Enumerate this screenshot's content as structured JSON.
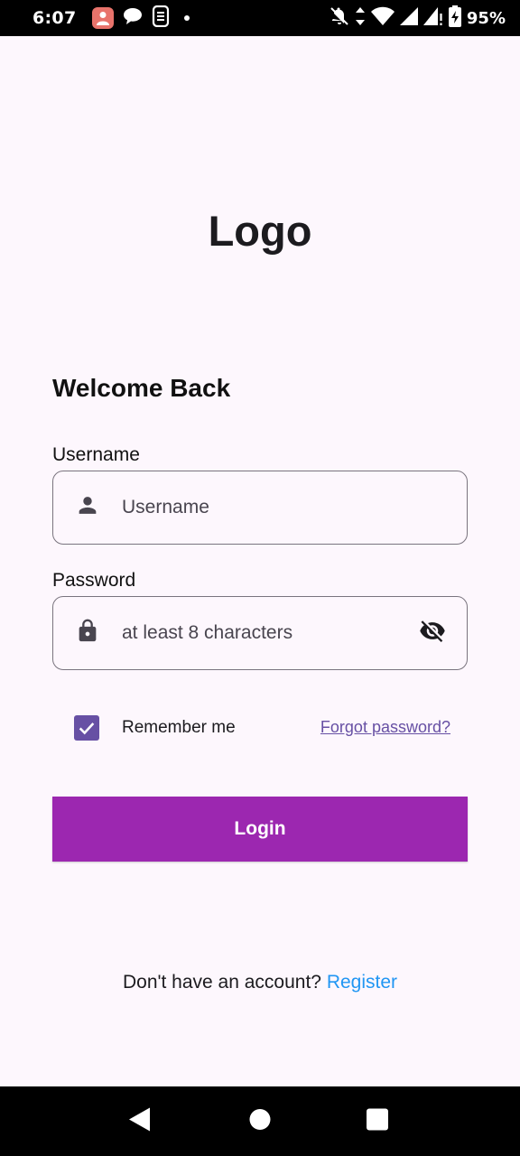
{
  "status_bar": {
    "time": "6:07",
    "battery": "95%",
    "icons": [
      "app-badge-icon",
      "chat-bubble-icon",
      "sim-icon",
      "notification-dot",
      "bell-off-icon",
      "data-arrows-icon",
      "wifi-icon",
      "signal-icon",
      "signal-no-data-icon",
      "battery-charging-icon"
    ]
  },
  "logo": "Logo",
  "welcome": "Welcome Back",
  "username": {
    "label": "Username",
    "placeholder": "Username",
    "icon": "person-icon"
  },
  "password": {
    "label": "Password",
    "placeholder": "at least 8 characters",
    "icon": "lock-icon",
    "toggle_icon": "visibility-off-icon"
  },
  "remember": {
    "label": "Remember me",
    "checked": true
  },
  "forgot_password": "Forgot password?",
  "login_button": "Login",
  "register": {
    "prompt": "Don't have an account?",
    "link": "Register"
  },
  "colors": {
    "background": "#fdf7fd",
    "primary_button": "#9c27b0",
    "checkbox": "#6750a4",
    "link": "#6750a4",
    "register_link": "#2196f3"
  }
}
